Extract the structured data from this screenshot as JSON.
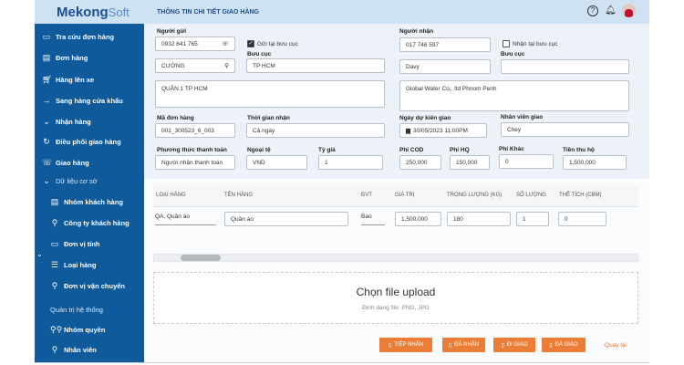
{
  "app": {
    "logo": "Mekong",
    "logo_suffix": "Soft",
    "title": "THÔNG TIN CHI TIẾT GIAO HÀNG"
  },
  "header": {
    "icons": [
      "help-icon",
      "bell-icon",
      "avatar"
    ]
  },
  "sidebar": {
    "items": [
      {
        "label": "Tra cứu đơn hàng",
        "icon": "archive-icon",
        "glyph": "▭"
      },
      {
        "label": "Đơn hàng",
        "icon": "list-icon",
        "glyph": "▤"
      },
      {
        "label": "Hàng lên xe",
        "icon": "cart-icon",
        "glyph": "🛒︎"
      },
      {
        "label": "Sang hàng cửa khẩu",
        "icon": "arrow-right-icon",
        "glyph": "→"
      },
      {
        "label": "Nhận hàng",
        "icon": "chevron-down-icon",
        "glyph": "⌄"
      },
      {
        "label": "Điều phối giao hàng",
        "icon": "refresh-icon",
        "glyph": "↻"
      },
      {
        "label": "Giao hàng",
        "icon": "phone-icon",
        "glyph": "☏"
      },
      {
        "label": "Dữ liệu cơ sở",
        "icon": "chevron-down-icon",
        "glyph": "⌄"
      },
      {
        "label": "Nhóm khách hàng",
        "icon": "list-icon",
        "glyph": "▤"
      },
      {
        "label": "Công ty khách hàng",
        "icon": "user-icon",
        "glyph": "⚲"
      },
      {
        "label": "Đơn vị tính",
        "icon": "folder-icon",
        "glyph": "▭"
      },
      {
        "label": "Loại hàng",
        "icon": "menu-icon",
        "glyph": "☰"
      },
      {
        "label": "Đơn vị vận chuyển",
        "icon": "user-icon",
        "glyph": "⚲"
      },
      {
        "label": "Quản trị hệ thống"
      },
      {
        "label": "Nhóm quyền",
        "icon": "users-icon",
        "glyph": "⚲⚲"
      },
      {
        "label": "Nhân viên",
        "icon": "user-icon",
        "glyph": "⚲"
      }
    ]
  },
  "sender": {
    "label": "Người gửi",
    "phone": "0932 641 765",
    "name": "CƯỜNG",
    "checkbox_label": "Gửi tại bưu cục",
    "checked": true,
    "post_office_label": "Bưu cục",
    "post_office": "TP HCM",
    "address": "QUẬN 1 TP HCM"
  },
  "receiver": {
    "label": "Người nhận",
    "phone": "017 746 597",
    "name": "Davy",
    "checkbox_label": "Nhận tại bưu cục",
    "checked": false,
    "post_office_label": "Bưu cục",
    "post_office": "",
    "address": "Global Water Co,. ltd  Phnom Penh"
  },
  "order": {
    "code_label": "Mã đơn hàng",
    "code": "001_300523_6_003",
    "time_label": "Thời gian nhận",
    "time": "Cả ngày",
    "payment_label": "Phương thức thanh toán",
    "payment": "Người nhận thanh toán",
    "currency_label": "Ngoại tệ",
    "currency": "VND",
    "rate_label": "Tỷ giá",
    "rate": "1",
    "delivery_date_label": "Ngày dự kiến giao",
    "delivery_date": "30/05/2023 11:00PM",
    "staff_label": "Nhân viên giao",
    "staff": "Chey",
    "cod_label": "Phí COD",
    "cod": "250,000",
    "hq_label": "Phí HQ",
    "hq": "150,000",
    "other_label": "Phí Khác",
    "other": "0",
    "collect_label": "Tiền thu hộ",
    "collect": "1,500,000"
  },
  "table": {
    "headers": [
      "LOẠI HÀNG",
      "TÊN HÀNG",
      "ĐVT",
      "GIÁ TRỊ",
      "TRỌNG LƯỢNG (KG)",
      "SỐ LƯỢNG",
      "THỂ TÍCH (CBM)"
    ],
    "rows": [
      [
        "QA, Quần áo",
        "Quần áo",
        "Bao",
        "1,500,000",
        "180",
        "1",
        "0"
      ]
    ]
  },
  "upload": {
    "title": "Chọn file upload",
    "subtitle": "Định dạng file: PNG, JPG"
  },
  "actions": {
    "receive": "TIẾP NHẬN",
    "received": "ĐÃ NHẬN",
    "delivering": "ĐI GIAO",
    "delivered": "ĐÃ GIAO",
    "back": "Quay lại"
  },
  "colors": {
    "sidebar": "#0e5a9b",
    "header": "#cfe2f4",
    "button": "#ec7d36"
  }
}
